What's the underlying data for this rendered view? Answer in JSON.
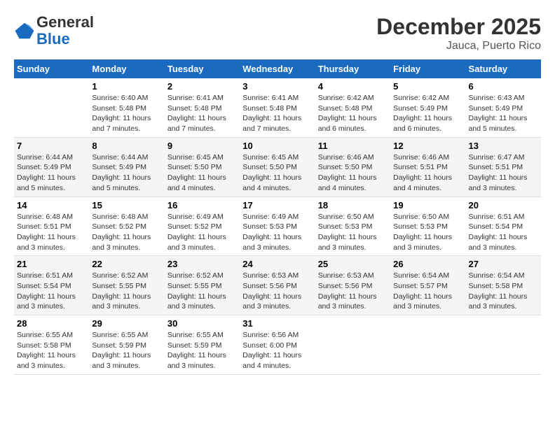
{
  "logo": {
    "general": "General",
    "blue": "Blue"
  },
  "title": "December 2025",
  "location": "Jauca, Puerto Rico",
  "days_of_week": [
    "Sunday",
    "Monday",
    "Tuesday",
    "Wednesday",
    "Thursday",
    "Friday",
    "Saturday"
  ],
  "weeks": [
    [
      {
        "day": "",
        "info": ""
      },
      {
        "day": "1",
        "info": "Sunrise: 6:40 AM\nSunset: 5:48 PM\nDaylight: 11 hours\nand 7 minutes."
      },
      {
        "day": "2",
        "info": "Sunrise: 6:41 AM\nSunset: 5:48 PM\nDaylight: 11 hours\nand 7 minutes."
      },
      {
        "day": "3",
        "info": "Sunrise: 6:41 AM\nSunset: 5:48 PM\nDaylight: 11 hours\nand 7 minutes."
      },
      {
        "day": "4",
        "info": "Sunrise: 6:42 AM\nSunset: 5:48 PM\nDaylight: 11 hours\nand 6 minutes."
      },
      {
        "day": "5",
        "info": "Sunrise: 6:42 AM\nSunset: 5:49 PM\nDaylight: 11 hours\nand 6 minutes."
      },
      {
        "day": "6",
        "info": "Sunrise: 6:43 AM\nSunset: 5:49 PM\nDaylight: 11 hours\nand 5 minutes."
      }
    ],
    [
      {
        "day": "7",
        "info": "Sunrise: 6:44 AM\nSunset: 5:49 PM\nDaylight: 11 hours\nand 5 minutes."
      },
      {
        "day": "8",
        "info": "Sunrise: 6:44 AM\nSunset: 5:49 PM\nDaylight: 11 hours\nand 5 minutes."
      },
      {
        "day": "9",
        "info": "Sunrise: 6:45 AM\nSunset: 5:50 PM\nDaylight: 11 hours\nand 4 minutes."
      },
      {
        "day": "10",
        "info": "Sunrise: 6:45 AM\nSunset: 5:50 PM\nDaylight: 11 hours\nand 4 minutes."
      },
      {
        "day": "11",
        "info": "Sunrise: 6:46 AM\nSunset: 5:50 PM\nDaylight: 11 hours\nand 4 minutes."
      },
      {
        "day": "12",
        "info": "Sunrise: 6:46 AM\nSunset: 5:51 PM\nDaylight: 11 hours\nand 4 minutes."
      },
      {
        "day": "13",
        "info": "Sunrise: 6:47 AM\nSunset: 5:51 PM\nDaylight: 11 hours\nand 3 minutes."
      }
    ],
    [
      {
        "day": "14",
        "info": "Sunrise: 6:48 AM\nSunset: 5:51 PM\nDaylight: 11 hours\nand 3 minutes."
      },
      {
        "day": "15",
        "info": "Sunrise: 6:48 AM\nSunset: 5:52 PM\nDaylight: 11 hours\nand 3 minutes."
      },
      {
        "day": "16",
        "info": "Sunrise: 6:49 AM\nSunset: 5:52 PM\nDaylight: 11 hours\nand 3 minutes."
      },
      {
        "day": "17",
        "info": "Sunrise: 6:49 AM\nSunset: 5:53 PM\nDaylight: 11 hours\nand 3 minutes."
      },
      {
        "day": "18",
        "info": "Sunrise: 6:50 AM\nSunset: 5:53 PM\nDaylight: 11 hours\nand 3 minutes."
      },
      {
        "day": "19",
        "info": "Sunrise: 6:50 AM\nSunset: 5:53 PM\nDaylight: 11 hours\nand 3 minutes."
      },
      {
        "day": "20",
        "info": "Sunrise: 6:51 AM\nSunset: 5:54 PM\nDaylight: 11 hours\nand 3 minutes."
      }
    ],
    [
      {
        "day": "21",
        "info": "Sunrise: 6:51 AM\nSunset: 5:54 PM\nDaylight: 11 hours\nand 3 minutes."
      },
      {
        "day": "22",
        "info": "Sunrise: 6:52 AM\nSunset: 5:55 PM\nDaylight: 11 hours\nand 3 minutes."
      },
      {
        "day": "23",
        "info": "Sunrise: 6:52 AM\nSunset: 5:55 PM\nDaylight: 11 hours\nand 3 minutes."
      },
      {
        "day": "24",
        "info": "Sunrise: 6:53 AM\nSunset: 5:56 PM\nDaylight: 11 hours\nand 3 minutes."
      },
      {
        "day": "25",
        "info": "Sunrise: 6:53 AM\nSunset: 5:56 PM\nDaylight: 11 hours\nand 3 minutes."
      },
      {
        "day": "26",
        "info": "Sunrise: 6:54 AM\nSunset: 5:57 PM\nDaylight: 11 hours\nand 3 minutes."
      },
      {
        "day": "27",
        "info": "Sunrise: 6:54 AM\nSunset: 5:58 PM\nDaylight: 11 hours\nand 3 minutes."
      }
    ],
    [
      {
        "day": "28",
        "info": "Sunrise: 6:55 AM\nSunset: 5:58 PM\nDaylight: 11 hours\nand 3 minutes."
      },
      {
        "day": "29",
        "info": "Sunrise: 6:55 AM\nSunset: 5:59 PM\nDaylight: 11 hours\nand 3 minutes."
      },
      {
        "day": "30",
        "info": "Sunrise: 6:55 AM\nSunset: 5:59 PM\nDaylight: 11 hours\nand 3 minutes."
      },
      {
        "day": "31",
        "info": "Sunrise: 6:56 AM\nSunset: 6:00 PM\nDaylight: 11 hours\nand 4 minutes."
      },
      {
        "day": "",
        "info": ""
      },
      {
        "day": "",
        "info": ""
      },
      {
        "day": "",
        "info": ""
      }
    ]
  ]
}
